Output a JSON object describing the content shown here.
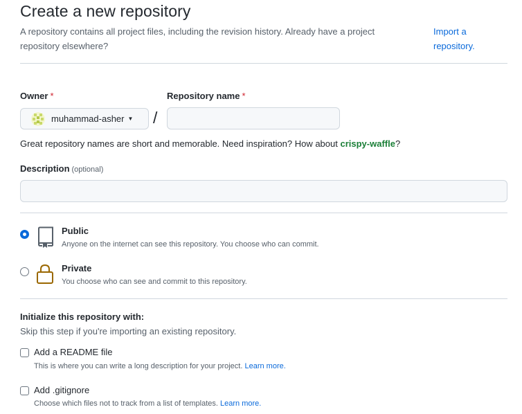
{
  "header": {
    "title": "Create a new repository",
    "description": "A repository contains all project files, including the revision history. Already have a project repository elsewhere?",
    "import_link": "Import a repository."
  },
  "owner": {
    "label": "Owner",
    "required_mark": "*",
    "selected": "muhammad-asher"
  },
  "repo_name": {
    "label": "Repository name",
    "required_mark": "*",
    "value": ""
  },
  "name_hint": {
    "text": "Great repository names are short and memorable. Need inspiration? How about",
    "suggestion": "crispy-waffle",
    "end": "?"
  },
  "description_field": {
    "label": "Description",
    "optional": "(optional)",
    "value": ""
  },
  "visibility": {
    "selected": "public",
    "options": [
      {
        "id": "public",
        "title": "Public",
        "desc": "Anyone on the internet can see this repository. You choose who can commit.",
        "icon": "repo-icon"
      },
      {
        "id": "private",
        "title": "Private",
        "desc": "You choose who can see and commit to this repository.",
        "icon": "lock-icon"
      }
    ]
  },
  "init": {
    "title": "Initialize this repository with:",
    "subtitle": "Skip this step if you're importing an existing repository.",
    "readme": {
      "label": "Add a README file",
      "desc": "This is where you can write a long description for your project.",
      "link": "Learn more.",
      "checked": false
    },
    "gitignore": {
      "label": "Add .gitignore",
      "desc": "Choose which files not to track from a list of templates.",
      "link": "Learn more.",
      "checked": false
    }
  },
  "colors": {
    "link": "#0969da",
    "radio_selected": "#0969da",
    "lock_icon": "#9a6700",
    "suggestion": "#1a7f37",
    "required": "#cf222e"
  }
}
